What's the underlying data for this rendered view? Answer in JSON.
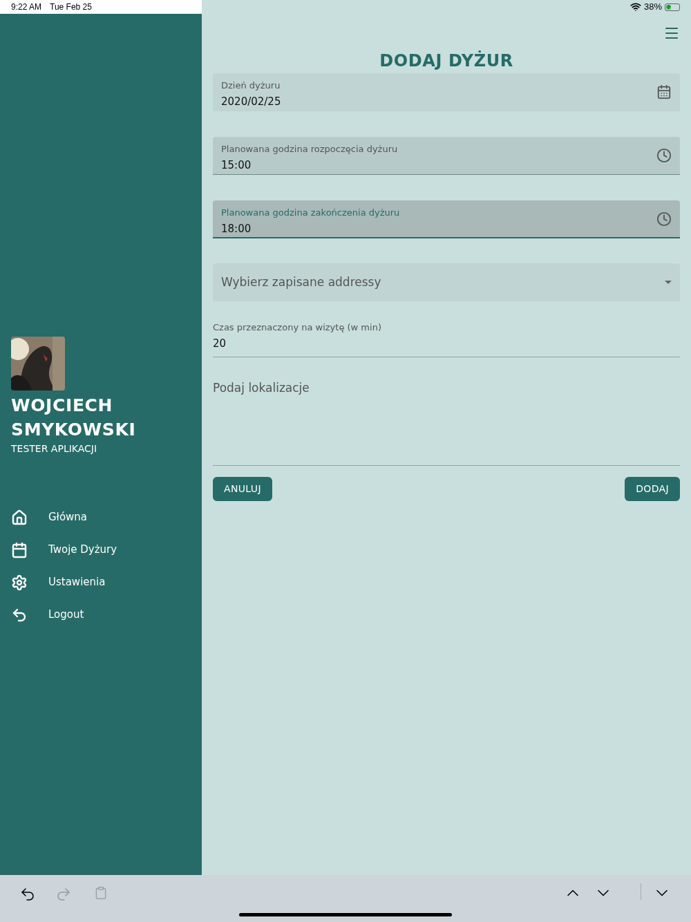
{
  "status_bar": {
    "time": "9:22 AM",
    "date": "Tue Feb 25",
    "battery": "38%"
  },
  "sidebar": {
    "name": "WOJCIECH SMYKOWSKI",
    "role": "TESTER APLIKACJI",
    "items": [
      {
        "label": "Główna"
      },
      {
        "label": "Twoje Dyżury"
      },
      {
        "label": "Ustawienia"
      },
      {
        "label": "Logout"
      }
    ]
  },
  "title": "DODAJ DYŻUR",
  "fields": [
    {
      "kind": "date",
      "label": "Dzień dyżuru",
      "value": "2020/02/25",
      "focused": false
    },
    {
      "kind": "time",
      "label": "Planowana godzina rozpoczęcia dyżuru",
      "value": "15:00",
      "focused": false
    },
    {
      "kind": "time",
      "label": "Planowana godzina zakończenia dyżuru",
      "value": "18:00",
      "focused": true
    },
    {
      "kind": "select",
      "placeholder": "Wybierz zapisane addressy"
    },
    {
      "kind": "text",
      "label": "Czas przeznaczony na wizytę (w min)",
      "value": "20"
    },
    {
      "kind": "textarea",
      "placeholder": "Podaj lokalizacje"
    }
  ],
  "buttons": [
    "ANULUJ",
    "DODAJ"
  ],
  "keyboard_bar": {
    "undo_disabled": false,
    "redo_disabled": true,
    "paste_disabled": true
  }
}
